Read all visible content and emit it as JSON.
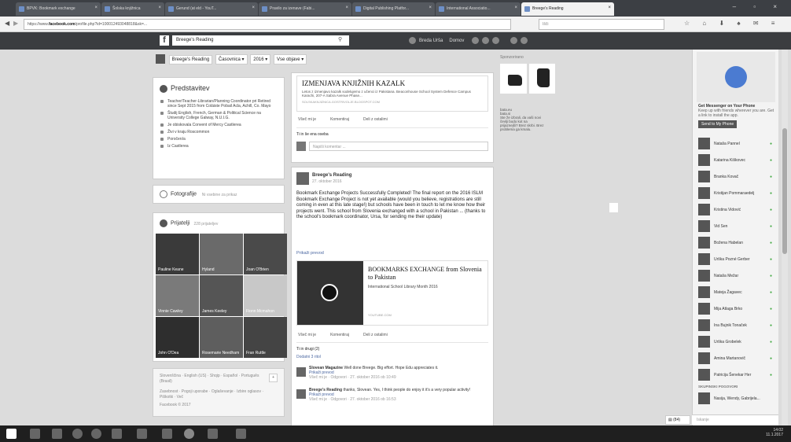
{
  "browser": {
    "tabs": [
      "BPVK: Bookmark exchange",
      "Šolska knjižnica",
      "Gerund (at eld - YouT...",
      "Pravilo za izenave (Fabi...",
      "Digital Publishing Platfor...",
      "International Associatio...",
      "Breege's Reading"
    ],
    "tab_close": "×",
    "window_controls": "– ▫ ×",
    "back": "◀",
    "forward": "▶",
    "url_prefix": "https://www.",
    "url_domain": "facebook.com",
    "url_rest": "/profile.php?id=100012493048818&sk=...",
    "search_placeholder": "Išči",
    "toolbar_icons": "☆ ⌂ ⬇ ♠ ✉ ≡"
  },
  "fb": {
    "logo": "f",
    "search_value": "Breege's Reading",
    "search_icon": "⚲",
    "nav_user": "Breda Urša",
    "nav_home": "Domov"
  },
  "page_header": {
    "name": "Breege's Reading",
    "timeline": "Časovnica ▾",
    "year": "2016 ▾",
    "view": "Vse objave ▾"
  },
  "intro": {
    "title": "Predstavitev",
    "items": [
      "Teacher/Teacher-Librarian/Planning Coordinator pri Retired since Sept 2015 from Coláiste Pobail Acla, Achill, Co. Mayo",
      "Študij English, French, German & Political Science na University College Galway, N.U.I.G.",
      "Je obiskovala Convent of Mercy Castlerea",
      "Živi v kraju Roscommon",
      "Poročen/a",
      "Iz Castlerea"
    ]
  },
  "photos_card": {
    "title": "Fotografije",
    "hint": "Ni vsebine za prikaz"
  },
  "friends_card": {
    "title": "Prijatelji",
    "count": "228 prijateljev",
    "names": [
      "Pauline Keane",
      "Hyland",
      "Joan O'Brien",
      "Vinnie Cawley",
      "James Keeley",
      "Fionn Mcmahon",
      "John O'Dea",
      "Rosemarie Needham",
      "Fran Ruttle"
    ]
  },
  "footer": {
    "langs": "Slovenščina · English (US) · Shqip · Español · Português (Brasil)",
    "add": "+",
    "links": "Zasebnost · Pogoji uporabe · Oglaševanje · Izbire oglasov · Piškotki · Več",
    "copyright": "Facebook © 2017"
  },
  "post1": {
    "link_title": "IZMENJAVA KNJIŽNIH KAZALK",
    "link_desc": "Letos z izmenjavo kazalk sodelujemo z učenci iz Pakistana. Beaconhouse School System Defence Campus Karachi, 207-A Sabra Avenue Phase...",
    "link_domain": "SOLSKAKNJIZNICA.GOSTRIVOLJE.BLOGSPOT.COM",
    "like": "Všeč mi je",
    "comment": "Komentiraj",
    "share": "Deli z ostalimi",
    "likes": "Ti in še ena oseba",
    "comment_placeholder": "Napiši komentar ..."
  },
  "post2": {
    "author": "Breege's Reading",
    "date": "27. oktober 2016",
    "text": "Bookmark Exchange Projects Successfully Completed! The final report on the 2016 ISLM Bookmark Exchange Project is not yet available (would you believe, registrations are still coming in even at this late stage!) but schools have been in touch to let me know how their projects went. This school from Slovenia exchanged with a school in Pakistan ... (thanks to the school's bookmark coordinator, Ursa, for sending me their update)",
    "translate": "Prikaži prevod",
    "video_title": "BOOKMARKS EXCHANGE from Slovenia to Pakistan",
    "video_sub": "International School Library Month 2016",
    "video_domain": "YOUTUBE.COM",
    "like": "Všeč mi je",
    "comment": "Komentiraj",
    "share": "Deli z ostalimi",
    "likes": "Ti in drugi (2)",
    "more": "Dodatni 3 ritol",
    "comments": [
      {
        "name": "Slovean Magazine",
        "text": "Well done Breege. Big effort. Hope Edu appreciates it.",
        "translate": "Prikaži prevod",
        "meta": "Všeč mi je · Odgovori · 27. oktober 2016 ob 10:49"
      },
      {
        "name": "Breege's Reading",
        "text": "thanks, Slovean. Yes, I think people do enjoy it it's a very popular activity!",
        "translate": "Prikaži prevod",
        "meta": "Všeč mi je · Odgovori · 27. oktober 2016 ob 16:53"
      }
    ]
  },
  "sponsored": {
    "title": "Sponzorirano",
    "ad_site": "bata.eu",
    "ad_lines": [
      "bata.si",
      "Ste že izbrali, da vaši novi čevlji bodo kot na prijaznejši? Brez skrbi. Brez problema ga kmalu."
    ]
  },
  "chat": {
    "promo_title": "Get Messenger on Your Phone",
    "promo_text": "Keep up with friends wherever you are. Get a link to install the app.",
    "promo_btn": "Send to My Phone",
    "friends": [
      "Nataša Pannel",
      "Katarina Kiškovec",
      "Branka Kovač",
      "Kristijan Pommaraedelj",
      "Kristina Vidović",
      "Vid Sen",
      "Božena Habelan",
      "Urška Pozné Gerber",
      "Nataša Mežar",
      "Mateja Žagavec",
      "Mija Atlaga Brko",
      "Ina Bujnik Tonaček",
      "Urška Grobelek",
      "Amina Martanovič",
      "Patricija Šenekar Her"
    ],
    "section": "SKUPINSKI POGOVORI",
    "group": "Nasija, Wendy, Gabrijela...",
    "search_placeholder": "Iskanje",
    "online": "(84)"
  },
  "taskbar": {
    "time": "14:02",
    "date": "11.1.2017"
  }
}
